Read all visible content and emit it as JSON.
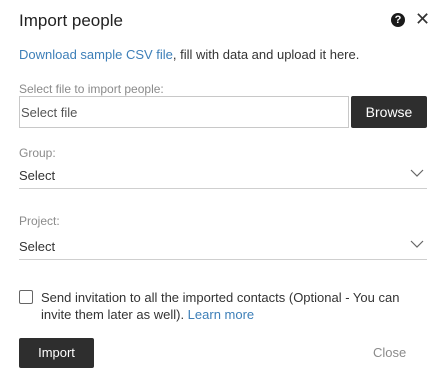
{
  "dialog": {
    "title": "Import people",
    "help_icon": "question-circle-icon",
    "help_glyph": "?",
    "close_glyph": "✕"
  },
  "intro": {
    "link_text": "Download sample CSV file",
    "rest_text": ", fill with data and upload it here."
  },
  "file_field": {
    "label": "Select file to import people:",
    "placeholder": "Select file",
    "browse_label": "Browse"
  },
  "group_field": {
    "label": "Group:",
    "selected": "Select",
    "icon": "chevron-down-icon"
  },
  "project_field": {
    "label": "Project:",
    "selected": "Select",
    "icon": "chevron-down-icon"
  },
  "invitation": {
    "checked": false,
    "text": "Send invitation to all the imported contacts (Optional - You can invite them later as well). ",
    "link_text": "Learn more"
  },
  "footer": {
    "import_label": "Import",
    "close_label": "Close"
  },
  "colors": {
    "link": "#3d7fb8",
    "button_dark": "#2e2e2e",
    "muted_text": "#8a8a8a"
  }
}
